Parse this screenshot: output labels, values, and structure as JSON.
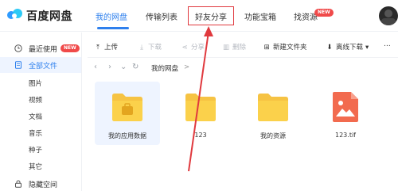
{
  "header": {
    "brand": "百度网盘",
    "tabs": [
      {
        "label": "我的网盘"
      },
      {
        "label": "传输列表"
      },
      {
        "label": "好友分享"
      },
      {
        "label": "功能宝箱"
      },
      {
        "label": "找资源",
        "badge": "NEW"
      }
    ],
    "accent_color": "#2f80ed",
    "highlight_color": "#e0393e"
  },
  "sidebar": {
    "items": [
      {
        "label": "最近使用",
        "icon": "clock-icon",
        "badge": "NEW"
      },
      {
        "label": "全部文件",
        "icon": "file-icon"
      },
      {
        "label": "图片"
      },
      {
        "label": "视频"
      },
      {
        "label": "文档"
      },
      {
        "label": "音乐"
      },
      {
        "label": "种子"
      },
      {
        "label": "其它"
      },
      {
        "label": "隐藏空间",
        "icon": "lock-icon"
      }
    ]
  },
  "toolbar": {
    "upload": "上传",
    "download": "下载",
    "share": "分享",
    "delete": "删除",
    "new_folder": "新建文件夹",
    "offline_download": "离线下载"
  },
  "breadcrumb": {
    "current": "我的网盘",
    "separator": ">"
  },
  "files": [
    {
      "name": "我的应用数据",
      "type": "app-folder-icon"
    },
    {
      "name": "123",
      "type": "folder-icon"
    },
    {
      "name": "我的资源",
      "type": "folder-icon"
    },
    {
      "name": "123.tif",
      "type": "image-file-icon"
    }
  ]
}
